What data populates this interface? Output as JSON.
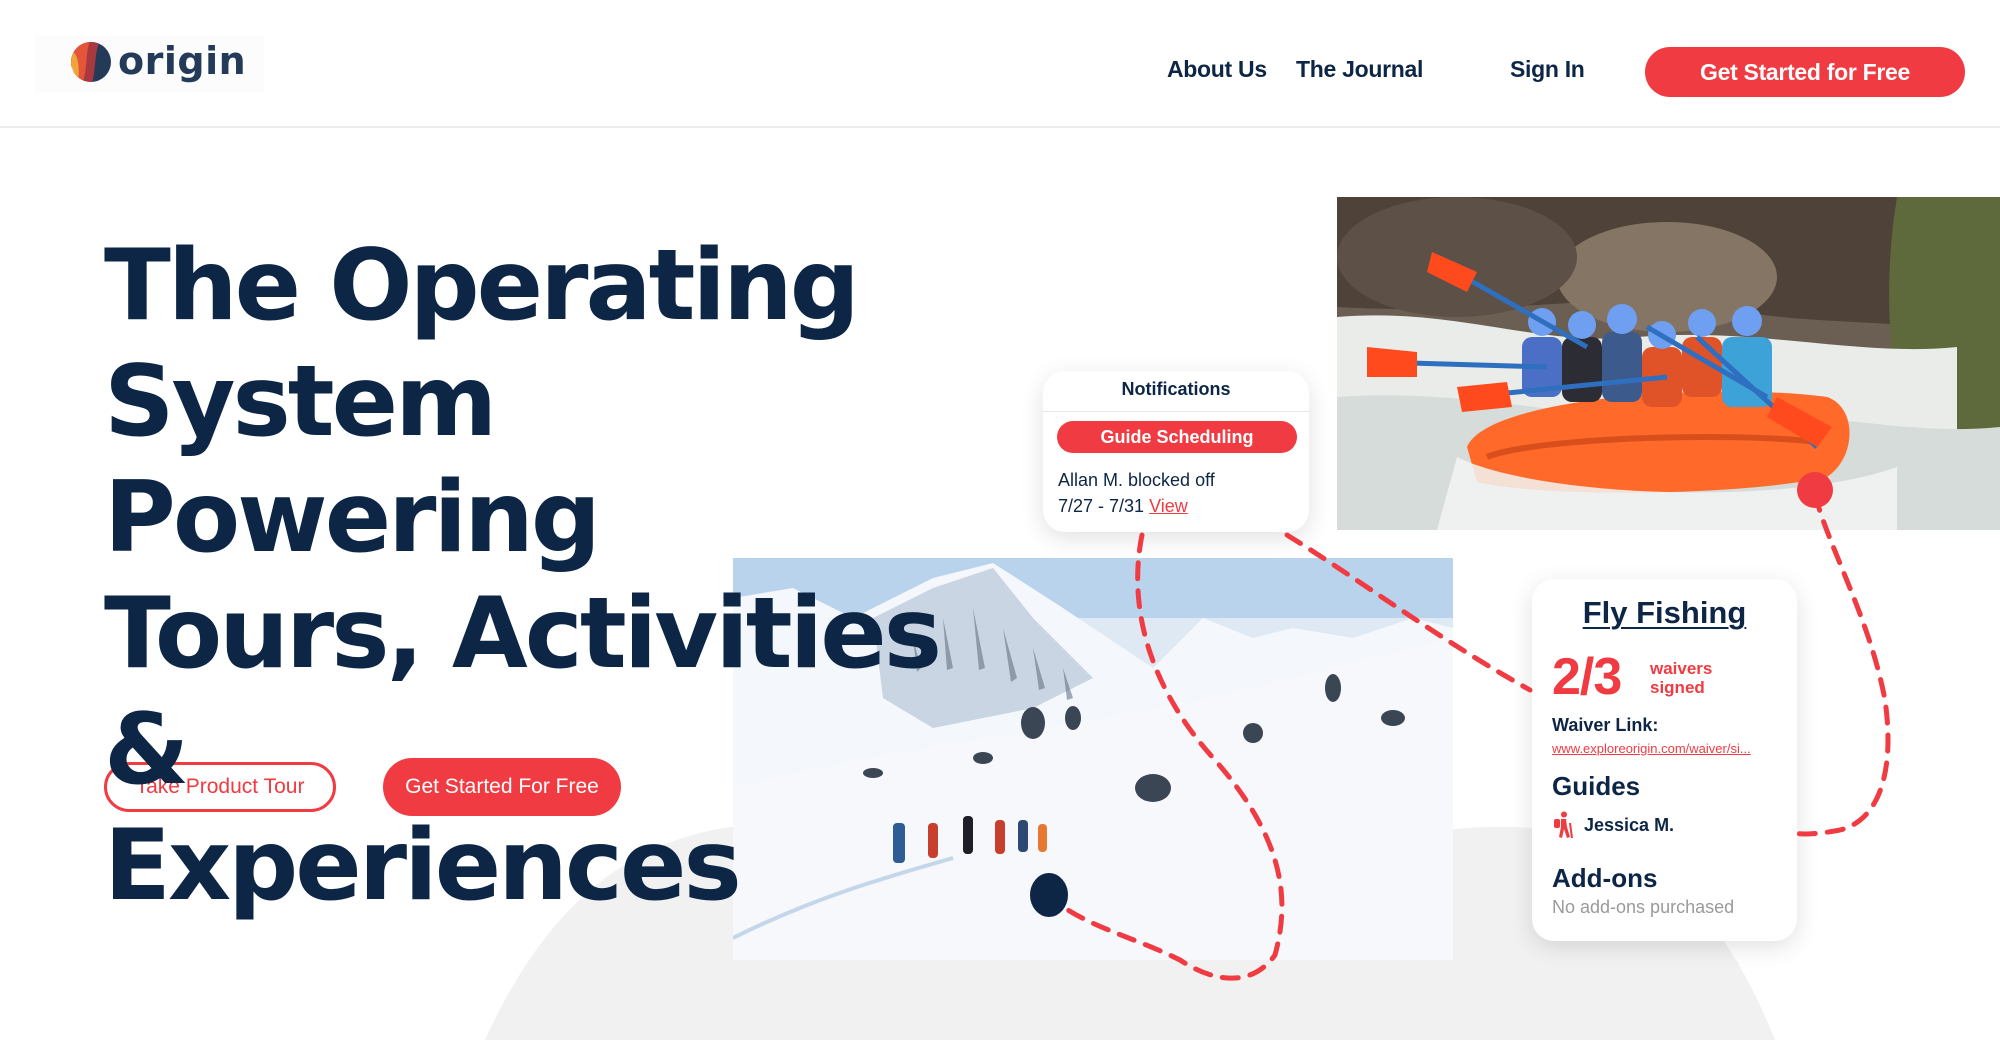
{
  "header": {
    "logo_text": "origin",
    "nav": [
      {
        "label": "About Us"
      },
      {
        "label": "The Journal"
      },
      {
        "label": "Sign In"
      }
    ],
    "cta_label": "Get Started for Free"
  },
  "hero": {
    "title_lines": [
      "The Operating",
      "System Powering",
      "Tours, Activities &",
      "Experiences"
    ],
    "tour_button": "Take Product Tour",
    "start_button": "Get Started For Free"
  },
  "images": {
    "raft_alt": "Whitewater rafting group",
    "snow_alt": "Ski touring group on snowy mountain"
  },
  "notification_card": {
    "title": "Notifications",
    "pill": "Guide Scheduling",
    "line1": "Allan M. blocked off",
    "dates": "7/27 - 7/31",
    "view_link": "View"
  },
  "activity_card": {
    "title": "Fly Fishing",
    "waivers_count": "2/3",
    "waivers_label_1": "waivers",
    "waivers_label_2": "signed",
    "waiver_link_label": "Waiver Link:",
    "waiver_link": "www.exploreorigin.com/waiver/si...",
    "guides_label": "Guides",
    "guide_name": "Jessica M.",
    "addons_label": "Add-ons",
    "addons_value": "No add-ons purchased"
  },
  "colors": {
    "brand_red": "#ef3b41",
    "navy": "#0d2646",
    "arc_grey": "#f1f1f1"
  }
}
